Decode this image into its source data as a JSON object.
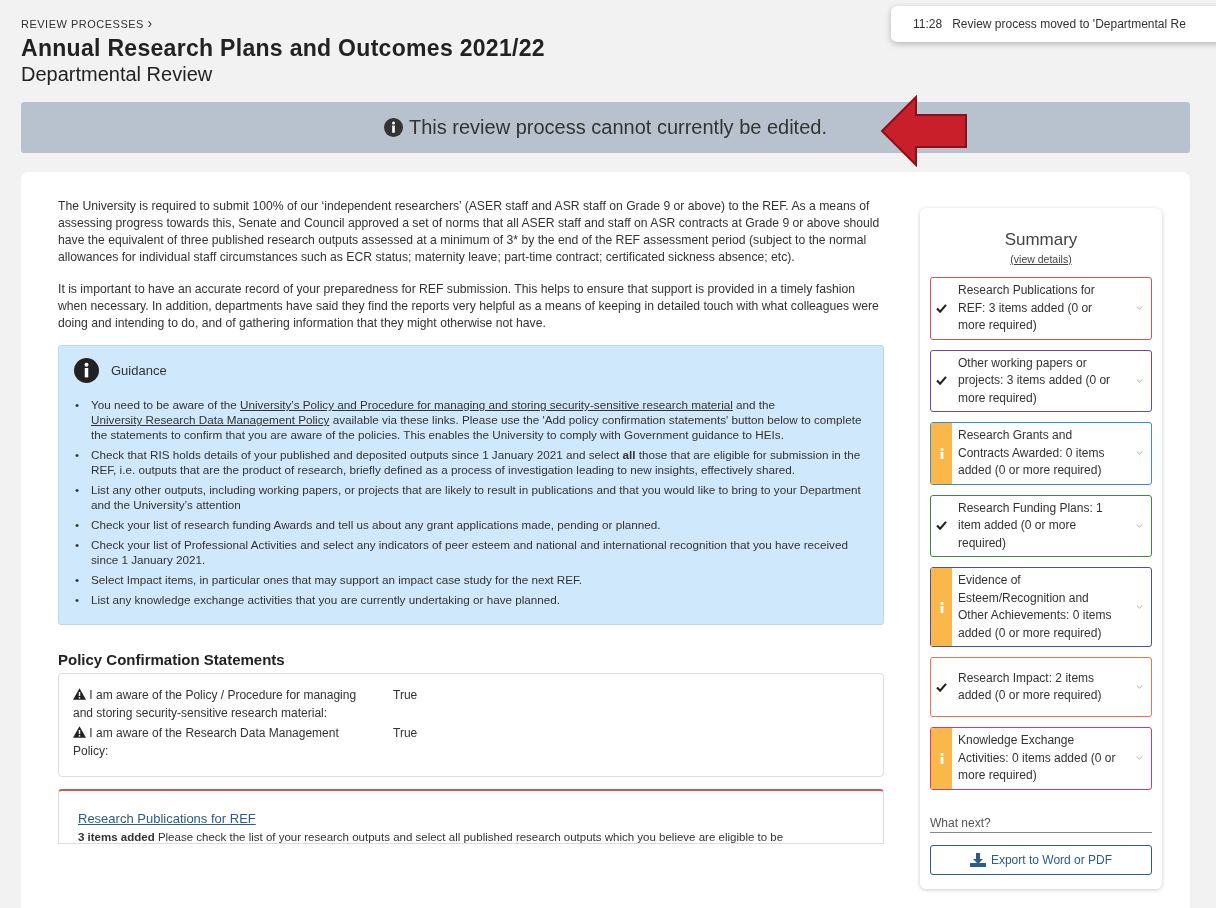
{
  "breadcrumb": {
    "label": "REVIEW PROCESSES",
    "separator": "›"
  },
  "title": "Annual Research Plans and Outcomes 2021/22",
  "subtitle": "Departmental Review",
  "toast": {
    "time": "11:28",
    "message": "Review process moved to 'Departmental Re"
  },
  "banner": {
    "message": "This review process cannot currently be edited."
  },
  "intro": [
    "The University is required to submit 100% of our ‘independent researchers’ (ASER staff and ASR staff on Grade 9 or above) to the REF.  As a means of assessing progress towards this, Senate and Council approved a set of norms that all ASER staff and staff on ASR contracts at Grade 9 or above should have the equivalent of three published research outputs assessed at a minimum of 3* by the end of the REF assessment period (subject to the normal allowances for individual staff circumstances such as ECR status; maternity leave; part-time contract; certificated sickness absence; etc).",
    "It is important to have an accurate record of your preparedness for REF submission.  This helps to ensure that support is provided in a timely fashion when necessary.  In addition, departments have said they find the reports very helpful as a means of keeping in detailed touch with what colleagues were doing and intending to do, and of gathering information that they might otherwise not have."
  ],
  "guidance": {
    "title": "Guidance",
    "items": [
      {
        "marker": "•",
        "parts": [
          {
            "text": "You need to be aware of the ",
            "link": false
          },
          {
            "text": "University’s Policy and Procedure for managing and storing security-sensitive research material",
            "link": true
          },
          {
            "text": " and the ",
            "link": false
          },
          {
            "text": "University Research Data Management Policy",
            "link": true
          },
          {
            "text": " available via these links. Please use the 'Add policy confirmation statements' button below to complete the statements to confirm that you are aware of the policies.  This enables the University to comply with Government guidance to HEIs.",
            "link": false
          }
        ]
      },
      {
        "marker": "•",
        "parts": [
          {
            "text": "Check that RIS holds details of your published and deposited outputs since 1 January 2021 and select **all** those that are eligible for submission in the REF, i.e. outputs that are the product of research, briefly defined as a process of investigation leading to new insights, effectively shared.",
            "link": false
          }
        ]
      },
      {
        "marker": "•",
        "parts": [
          {
            "text": "List any other outputs, including working papers, or projects that are likely to result in publications and that you would like to bring to your Department and the University’s attention",
            "link": false
          }
        ]
      },
      {
        "marker": "•",
        "parts": [
          {
            "text": "Check your list of research funding Awards and tell us about any grant applications made, pending or planned.",
            "link": false
          }
        ]
      },
      {
        "marker": "•",
        "parts": [
          {
            "text": "Check your list of Professional Activities and select any indicators of peer esteem and national and international recognition that you have received since 1 January 2021.",
            "link": false
          }
        ]
      },
      {
        "marker": "•",
        "parts": [
          {
            "text": "Select Impact items, in particular ones that may support an impact case study for the next REF.",
            "link": false
          }
        ]
      },
      {
        "marker": "•",
        "parts": [
          {
            "text": "List any knowledge exchange activities that you are currently undertaking or have planned.",
            "link": false
          }
        ]
      }
    ]
  },
  "policy": {
    "title": "Policy Confirmation Statements",
    "statements": [
      {
        "label": "I am aware of the Policy / Procedure for managing and storing security-sensitive research material:",
        "value": "True"
      },
      {
        "label": "I am aware of the Research Data Management Policy:",
        "value": "True"
      }
    ]
  },
  "section": {
    "title": "Research Publications for REF",
    "count": "3 items added",
    "text": "  Please check the list of your research outputs and select all published research outputs which you believe are eligible to be",
    "color": "#d9534f"
  },
  "summary": {
    "title": "Summary",
    "link": "(view details)",
    "items": [
      {
        "kind": "done",
        "text": "Research Publications for REF: 3 items added (0 or more required)",
        "color": "#d9534f"
      },
      {
        "kind": "done",
        "text": "Other working papers or projects: 3 items added (0 or more required)",
        "color": "#6f42c1"
      },
      {
        "kind": "info",
        "text": "Research Grants and Contracts Awarded: 0 items added (0 or more required)",
        "color": "#3a8fc8"
      },
      {
        "kind": "done",
        "text": "Research Funding Plans: 1 item added (0 or more required)",
        "color": "#3c8a3c"
      },
      {
        "kind": "info",
        "text": "Evidence of Esteem/Recognition and Other Achievements: 0 items added (0 or more required)",
        "color": "#4a4fa8"
      },
      {
        "kind": "done",
        "text": "Research Impact: 2 items added (0 or more required)",
        "color": "#e8764a"
      },
      {
        "kind": "info",
        "text": "Knowledge Exchange Activities: 0 items added (0 or more required)",
        "color": "#cc3d78"
      }
    ],
    "next_label": "What next?",
    "export_button": "Export to Word or PDF"
  }
}
